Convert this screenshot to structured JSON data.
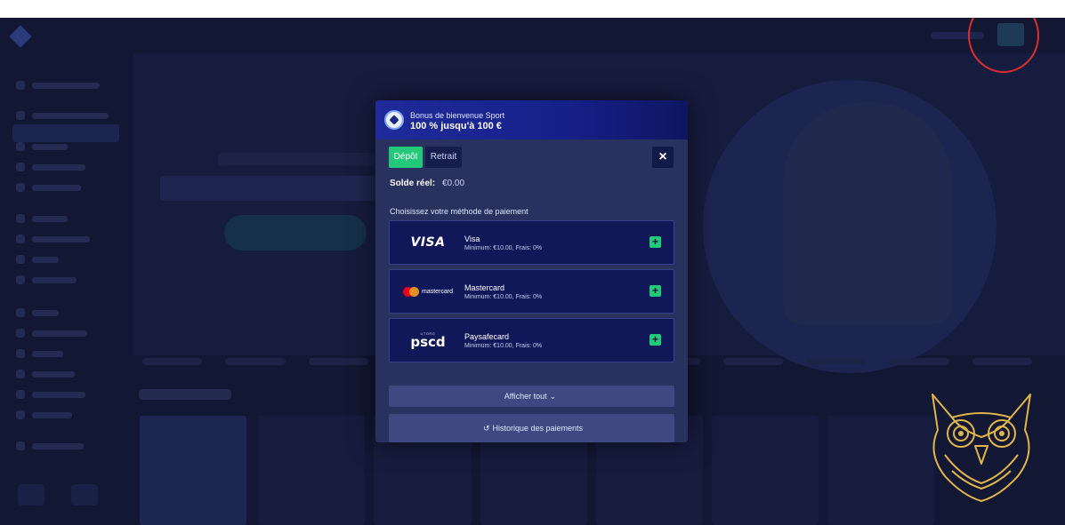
{
  "header": {
    "subtitle": "Bonus de bienvenue Sport",
    "title": "100 % jusqu'à 100 €"
  },
  "tabs": {
    "deposit": "Dépôt",
    "withdraw": "Retrait"
  },
  "close_icon": "×",
  "balance": {
    "label": "Solde réel:",
    "value": "€0.00"
  },
  "payment": {
    "prompt": "Choisissez votre méthode de paiement",
    "methods": [
      {
        "name": "Visa",
        "info": "Minimum: €10.00, Frais: 0%",
        "logo_text": "VISA"
      },
      {
        "name": "Mastercard",
        "info": "Minimum: €10.00, Frais: 0%",
        "logo_text": "mastercard"
      },
      {
        "name": "Paysafecard",
        "info": "Minimum: €10.00, Frais: 0%",
        "logo_text": "pscd",
        "logo_small": "UTORG"
      }
    ],
    "add_symbol": "+"
  },
  "show_all": {
    "label": "Afficher tout",
    "icon": "⌄"
  },
  "history": {
    "label": "Historique des paiements",
    "icon": "↺"
  },
  "colors": {
    "accent_green": "#21c978",
    "modal_bg": "#29315f",
    "header_blue": "#1f2b9a",
    "annotation_red": "#d9302c",
    "owl_gold": "#e2b64a"
  }
}
